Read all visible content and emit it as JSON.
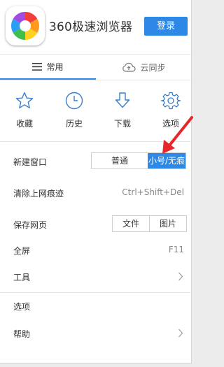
{
  "header": {
    "app_title": "360极速浏览器",
    "login_label": "登录",
    "logo_icon": "browser-360-logo"
  },
  "tabs": {
    "common_label": "常用",
    "sync_label": "云同步"
  },
  "quick": {
    "items": [
      {
        "label": "收藏",
        "icon": "star-icon"
      },
      {
        "label": "历史",
        "icon": "clock-icon"
      },
      {
        "label": "下载",
        "icon": "download-icon"
      },
      {
        "label": "选项",
        "icon": "gear-icon"
      }
    ]
  },
  "menu": {
    "new_window": {
      "label": "新建窗口",
      "normal": "普通",
      "incognito": "小号/无痕"
    },
    "clear_traces": {
      "label": "清除上网痕迹",
      "shortcut": "Ctrl+Shift+Del"
    },
    "save_page": {
      "label": "保存网页",
      "file": "文件",
      "image": "图片"
    },
    "fullscreen": {
      "label": "全屏",
      "shortcut": "F11"
    },
    "tools": {
      "label": "工具"
    },
    "options": {
      "label": "选项"
    },
    "help": {
      "label": "帮助"
    }
  },
  "colors": {
    "accent": "#2e88e6",
    "annotation_arrow": "#e8262a"
  }
}
